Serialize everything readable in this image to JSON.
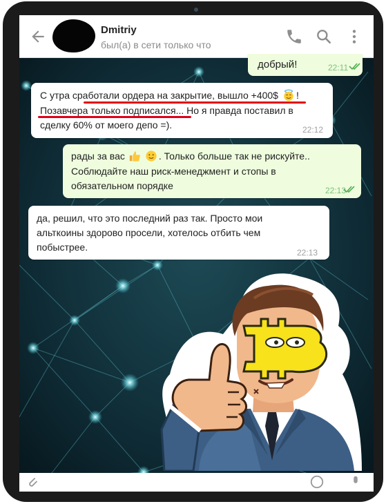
{
  "header": {
    "title": "Dmitriy",
    "status": "был(а) в сети только что",
    "icons": [
      "back-arrow-icon",
      "phone-icon",
      "search-icon",
      "more-vert-icon"
    ]
  },
  "colors": {
    "header_bg": "#ffffff",
    "incoming_bubble": "#ffffff",
    "outgoing_bubble": "#effdde",
    "read_checks": "#4fae4e",
    "underline": "#e0001a",
    "chat_bg": "#0b1f27"
  },
  "messages": [
    {
      "direction": "out",
      "text": "добрый!",
      "time": "22:11",
      "read": true
    },
    {
      "direction": "in",
      "line1_prefix": "С утра ",
      "line1_marked": "сработали ордера на закрытие, вышло +400$",
      "line1_suffix": "!",
      "line2_marked": "Позавчера только подписался",
      "line2_suffix": "... Но я правда поставил в",
      "line3": "сделку 60% от моего депо  =).",
      "emoji": "smiling-face-with-halo-emoji",
      "time": "22:12"
    },
    {
      "direction": "out",
      "line1_prefix": "рады за вас",
      "line1_suffix": ". Только больше так не рискуйте..",
      "line2": "Соблюдайте наш риск-менеджмент и стопы в",
      "line3": "обязательном порядке",
      "emojis": [
        "thumbs-up-emoji",
        "slightly-smiling-emoji"
      ],
      "time": "22:13",
      "read": true
    },
    {
      "direction": "in",
      "line1": "да, решил, что это последний раз так. Просто мои",
      "line2": "альткоины здорово просели, хотелось отбить чем",
      "line3": "побыстрее.",
      "time": "22:13"
    }
  ],
  "sticker": {
    "name": "bitcoin-mask-businessman-thumbs-up-sticker",
    "mask_symbol": "₿"
  }
}
